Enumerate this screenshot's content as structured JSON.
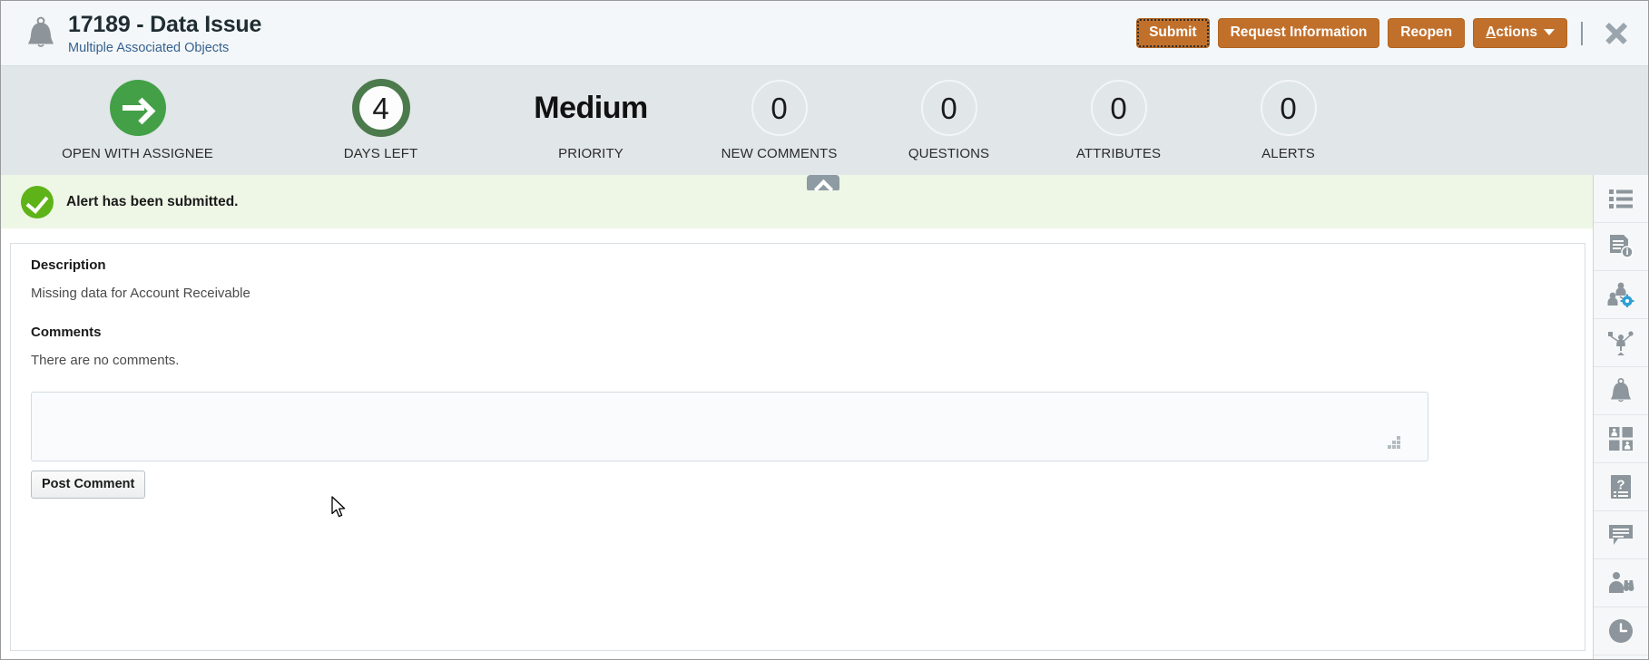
{
  "header": {
    "icon": "bell-icon",
    "title": "17189 - Data Issue",
    "subtitle": "Multiple Associated Objects",
    "buttons": [
      {
        "label": "Submit",
        "name": "submit-button",
        "focused": true
      },
      {
        "label": "Request Information",
        "name": "request-information-button",
        "focused": false
      },
      {
        "label": "Reopen",
        "name": "reopen-button",
        "focused": false
      }
    ],
    "actions_menu": {
      "label": "Actions",
      "accel": "A",
      "rest": "ctions",
      "caret": "chevron-down-icon"
    },
    "close_icon": "close-icon",
    "accent_color": "#c1702c",
    "bar_color": "#f4f7f9"
  },
  "status": {
    "background": "#e1e6e9",
    "items": [
      {
        "name": "status-open-with-assignee",
        "kind": "arrow",
        "value": "",
        "label": "OPEN WITH ASSIGNEE",
        "color": "#43a047"
      },
      {
        "name": "status-days-left",
        "kind": "ring-green",
        "value": "4",
        "label": "DAYS LEFT",
        "color": "#4c7a4c"
      },
      {
        "name": "status-priority",
        "kind": "text",
        "value": "Medium",
        "label": "PRIORITY",
        "color": "#111111"
      },
      {
        "name": "status-new-comments",
        "kind": "ring-plain",
        "value": "0",
        "label": "NEW COMMENTS",
        "color": "#f3f6f7"
      },
      {
        "name": "status-questions",
        "kind": "ring-plain",
        "value": "0",
        "label": "QUESTIONS",
        "color": "#f3f6f7"
      },
      {
        "name": "status-attributes",
        "kind": "ring-plain",
        "value": "0",
        "label": "ATTRIBUTES",
        "color": "#f3f6f7"
      },
      {
        "name": "status-alerts",
        "kind": "ring-plain",
        "value": "0",
        "label": "ALERTS",
        "color": "#f3f6f7"
      }
    ],
    "collapse_icon": "chevron-up-icon"
  },
  "alert": {
    "icon": "success-check-icon",
    "message": "Alert has been submitted.",
    "background": "#eef7e6",
    "icon_color": "#5eb318"
  },
  "main": {
    "description_heading": "Description",
    "description_text": "Missing data for Account Receivable",
    "comments_heading": "Comments",
    "no_comments_text": "There are no comments.",
    "comment_input_value": "",
    "comment_input_placeholder": "",
    "post_comment_label": "Post Comment"
  },
  "rail": {
    "items": [
      {
        "name": "rail-item-details-list",
        "icon": "list-icon"
      },
      {
        "name": "rail-item-document-info",
        "icon": "document-info-icon"
      },
      {
        "name": "rail-item-assignees",
        "icon": "people-gear-icon"
      },
      {
        "name": "rail-item-hierarchy",
        "icon": "org-hierarchy-icon"
      },
      {
        "name": "rail-item-alerts",
        "icon": "bell-icon"
      },
      {
        "name": "rail-item-related-objects",
        "icon": "quadrant-grid-icon"
      },
      {
        "name": "rail-item-questions",
        "icon": "question-document-icon"
      },
      {
        "name": "rail-item-comments",
        "icon": "comment-bubble-icon"
      },
      {
        "name": "rail-item-watchers",
        "icon": "person-binoculars-icon"
      },
      {
        "name": "rail-item-history",
        "icon": "clock-icon"
      }
    ]
  }
}
